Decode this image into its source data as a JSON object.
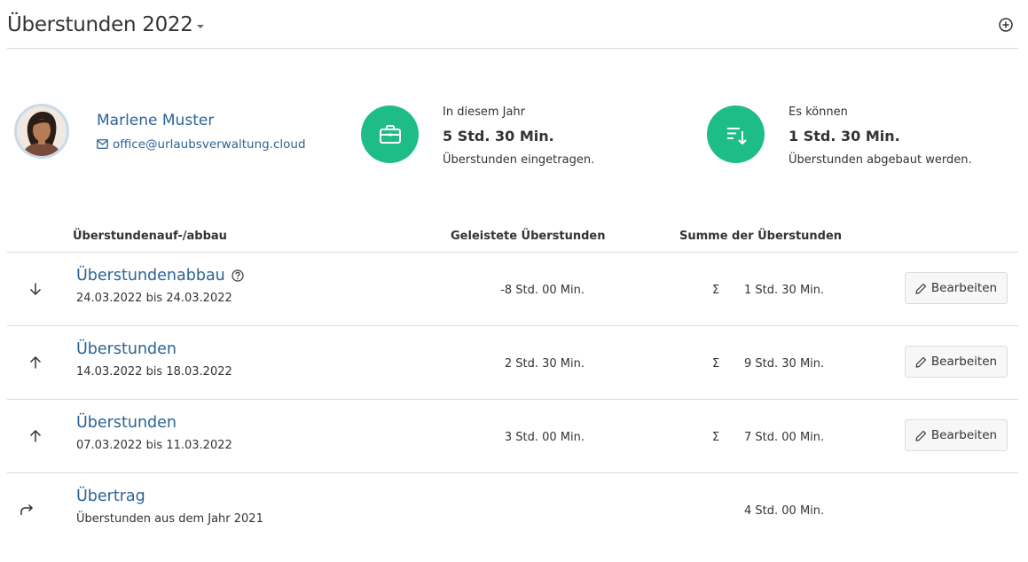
{
  "header": {
    "title": "Überstunden 2022",
    "add_icon": "plus-circle-icon"
  },
  "person": {
    "name": "Marlene Muster",
    "email": "office@urlaubsverwaltung.cloud"
  },
  "stats": [
    {
      "icon": "briefcase-icon",
      "top": "In diesem Jahr",
      "value": "5 Std. 30 Min.",
      "bottom": "Überstunden eingetragen."
    },
    {
      "icon": "sort-down-icon",
      "top": "Es können",
      "value": "1 Std. 30 Min.",
      "bottom": "Überstunden abgebaut werden."
    }
  ],
  "table": {
    "headers": {
      "type": "Überstundenauf-/abbau",
      "worked": "Geleistete Überstunden",
      "sum": "Summe der Überstunden"
    },
    "rows": [
      {
        "icon": "arrow-down-icon",
        "title": "Überstundenabbau",
        "subtitle": "24.03.2022 bis 24.03.2022",
        "worked": "-8 Std. 00 Min.",
        "sigma": "Σ",
        "sum": "1 Std. 30 Min.",
        "edit": "Bearbeiten"
      },
      {
        "icon": "arrow-up-icon",
        "title": "Überstunden",
        "subtitle": "14.03.2022 bis 18.03.2022",
        "worked": "2 Std. 30 Min.",
        "sigma": "Σ",
        "sum": "9 Std. 30 Min.",
        "edit": "Bearbeiten"
      },
      {
        "icon": "arrow-up-icon",
        "title": "Überstunden",
        "subtitle": "07.03.2022 bis 11.03.2022",
        "worked": "3 Std. 00 Min.",
        "sigma": "Σ",
        "sum": "7 Std. 00 Min.",
        "edit": "Bearbeiten"
      },
      {
        "icon": "forward-arrow-icon",
        "title": "Übertrag",
        "subtitle": "Überstunden aus dem Jahr 2021",
        "sum": "4 Std. 00 Min."
      }
    ]
  },
  "colors": {
    "accent_green": "#1ebc86",
    "link_blue": "#2a6496",
    "divider": "#dcdcdc"
  }
}
